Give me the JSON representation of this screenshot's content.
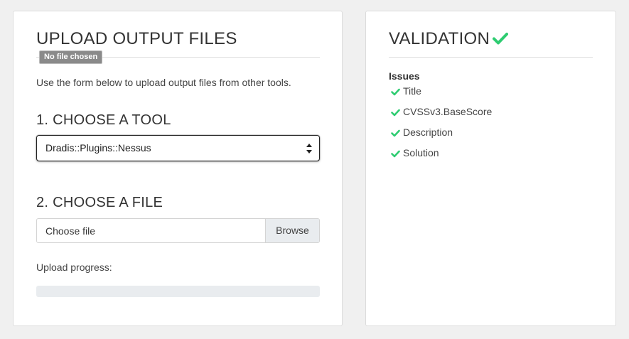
{
  "upload": {
    "title": "UPLOAD OUTPUT FILES",
    "tooltip": "No file chosen",
    "intro": "Use the form below to upload output files from other tools.",
    "step1": "1. CHOOSE A TOOL",
    "tool_selected": "Dradis::Plugins::Nessus",
    "step2": "2. CHOOSE A FILE",
    "file_placeholder": "Choose file",
    "browse_label": "Browse",
    "progress_label": "Upload progress:",
    "progress_value": 0
  },
  "validation": {
    "title": "VALIDATION",
    "status_icon": "check-icon",
    "issues_heading": "Issues",
    "issues": [
      {
        "label": "Title",
        "icon": "check-icon"
      },
      {
        "label": "CVSSv3.BaseScore",
        "icon": "check-icon"
      },
      {
        "label": "Description",
        "icon": "check-icon"
      },
      {
        "label": "Solution",
        "icon": "check-icon"
      }
    ]
  },
  "colors": {
    "success": "#2ecc71",
    "progress_track": "#e9ecef"
  }
}
